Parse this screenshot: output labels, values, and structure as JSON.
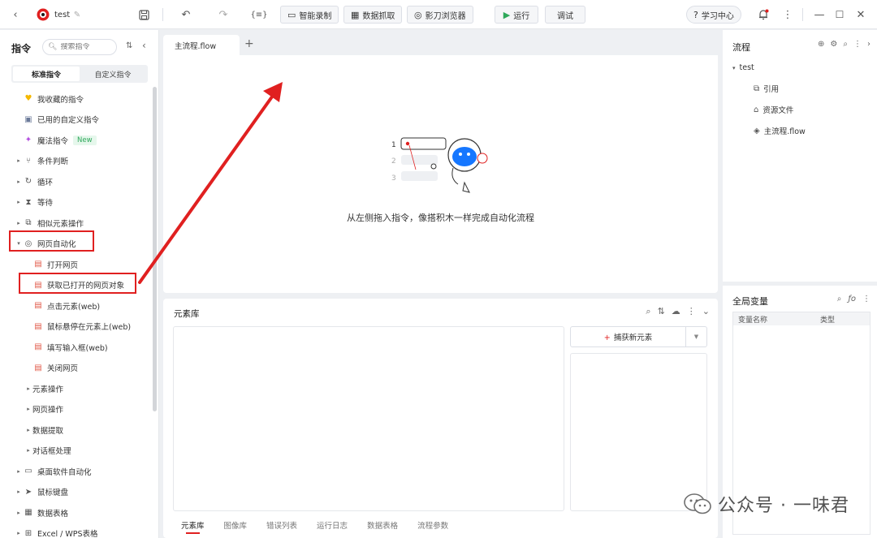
{
  "topbar": {
    "project_name": "test",
    "smart_record": "智能录制",
    "data_capture": "数据抓取",
    "browser": "影刀浏览器",
    "run": "运行",
    "debug": "调试",
    "learning_center": "学习中心"
  },
  "sidebar": {
    "title": "指令",
    "search_placeholder": "搜索指令",
    "tabs": [
      "标准指令",
      "自定义指令"
    ],
    "items": [
      {
        "label": "我收藏的指令"
      },
      {
        "label": "已用的自定义指令"
      },
      {
        "label": "魔法指令",
        "badge": "New"
      },
      {
        "label": "条件判断"
      },
      {
        "label": "循环"
      },
      {
        "label": "等待"
      },
      {
        "label": "相似元素操作"
      },
      {
        "label": "网页自动化"
      },
      {
        "label": "打开网页"
      },
      {
        "label": "获取已打开的网页对象"
      },
      {
        "label": "点击元素(web)"
      },
      {
        "label": "鼠标悬停在元素上(web)"
      },
      {
        "label": "填写输入框(web)"
      },
      {
        "label": "关闭网页"
      },
      {
        "label": "元素操作"
      },
      {
        "label": "网页操作"
      },
      {
        "label": "数据提取"
      },
      {
        "label": "对话框处理"
      },
      {
        "label": "桌面软件自动化"
      },
      {
        "label": "鼠标键盘"
      },
      {
        "label": "数据表格"
      },
      {
        "label": "Excel / WPS表格"
      }
    ]
  },
  "editor": {
    "tab": "主流程.flow",
    "empty_hint": "从左侧拖入指令，像搭积木一样完成自动化流程",
    "line_numbers": [
      "1",
      "2",
      "3"
    ]
  },
  "element_library": {
    "title": "元素库",
    "capture_button": "捕获新元素",
    "bottom_tabs": [
      "元素库",
      "图像库",
      "错误列表",
      "运行日志",
      "数据表格",
      "流程参数"
    ]
  },
  "flow_panel": {
    "title": "流程",
    "root": "test",
    "items": [
      "引用",
      "资源文件",
      "主流程.flow"
    ]
  },
  "var_panel": {
    "title": "全局变量",
    "columns": [
      "变量名称",
      "类型"
    ]
  },
  "watermark": "公众号 · 一味君",
  "colors": {
    "accent_red": "#e02020",
    "run_green": "#2ea85a"
  }
}
